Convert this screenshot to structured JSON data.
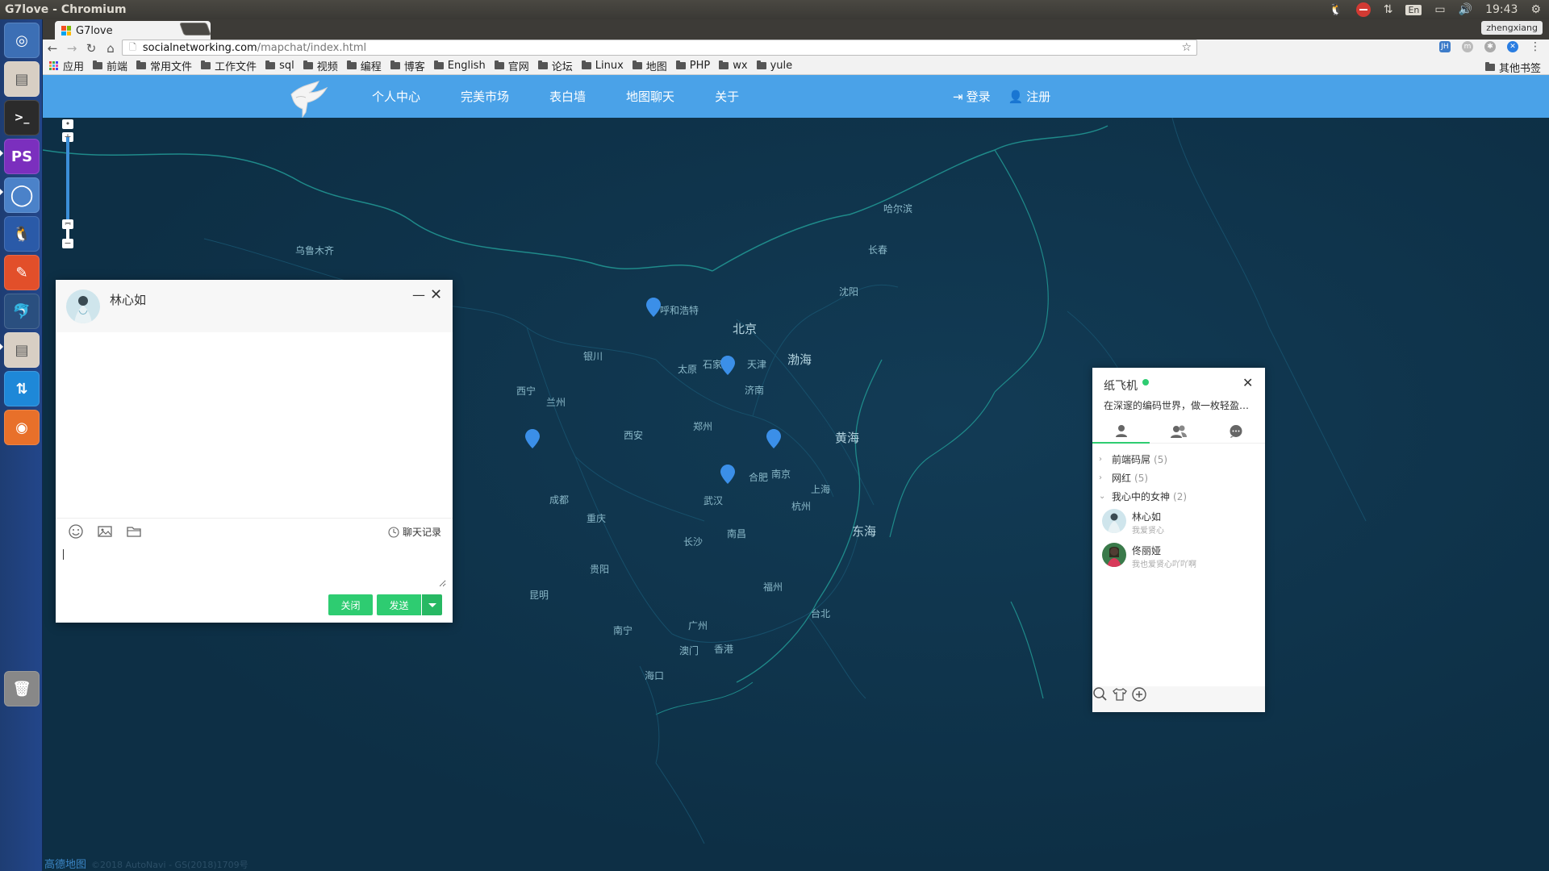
{
  "os": {
    "window_title": "G7love - Chromium",
    "tray": {
      "lang": "En",
      "time": "19:43",
      "user": "zhengxiang"
    }
  },
  "browser": {
    "tab_title": "G7love",
    "url_host": "socialnetworking.com",
    "url_path": "/mapchat/index.html",
    "bookmarks": [
      "应用",
      "前端",
      "常用文件",
      "工作文件",
      "sql",
      "视频",
      "编程",
      "博客",
      "English",
      "官网",
      "论坛",
      "Linux",
      "地图",
      "PHP",
      "wx",
      "yule"
    ],
    "other_bookmarks": "其他书签",
    "ext_icons": [
      "jh-icon",
      "m-icon",
      "gear-icon",
      "x-icon",
      "menu-icon"
    ]
  },
  "site": {
    "nav": [
      "个人中心",
      "完美市场",
      "表白墙",
      "地图聊天",
      "关于"
    ],
    "login": "登录",
    "register": "注册"
  },
  "map": {
    "cities": {
      "wulumuqi": "乌鲁木齐",
      "haerbin": "哈尔滨",
      "changchun": "长春",
      "shenyang": "沈阳",
      "huhehaote": "呼和浩特",
      "beijing": "北京",
      "tianjin": "天津",
      "shijiazhuang": "石家庄",
      "taiyuan": "太原",
      "jinan": "济南",
      "yinchuan": "银川",
      "xining": "西宁",
      "lanzhou": "兰州",
      "xian": "西安",
      "zhengzhou": "郑州",
      "hefei": "合肥",
      "nanjing": "南京",
      "shanghai": "上海",
      "hangzhou": "杭州",
      "wuhan": "武汉",
      "chengdu": "成都",
      "chongqing": "重庆",
      "changsha": "长沙",
      "nanchang": "南昌",
      "guiyang": "贵阳",
      "kunming": "昆明",
      "fuzhou": "福州",
      "taibei": "台北",
      "nanning": "南宁",
      "guangzhou": "广州",
      "aomen": "澳门",
      "xianggang": "香港",
      "haikou": "海口",
      "bohai": "渤海",
      "huanghai": "黄海",
      "donghai": "东海"
    },
    "credit": "高德地图",
    "credit_small": "©2018 AutoNavi - GS(2018)1709号"
  },
  "chat": {
    "contact_name": "林心如",
    "minimize": "—",
    "close_icon": "✕",
    "history": "聊天记录",
    "input_value": "",
    "close_btn": "关闭",
    "send_btn": "发送"
  },
  "panel": {
    "name": "纸飞机",
    "sign": "在深邃的编码世界，做一枚轻盈的纯粹",
    "groups": [
      {
        "name": "前端码屌",
        "count": "(5)"
      },
      {
        "name": "网红",
        "count": "(5)"
      },
      {
        "name": "我心中的女神",
        "count": "(2)"
      }
    ],
    "friends": [
      {
        "name": "林心如",
        "sign": "我爱贤心"
      },
      {
        "name": "佟丽娅",
        "sign": "我也爱贤心吖吖啊"
      }
    ]
  },
  "colors": {
    "header": "#4aa2e8",
    "map_bg": "#0d2f45",
    "marker": "#3b8fe8",
    "accent": "#2ecc71"
  }
}
